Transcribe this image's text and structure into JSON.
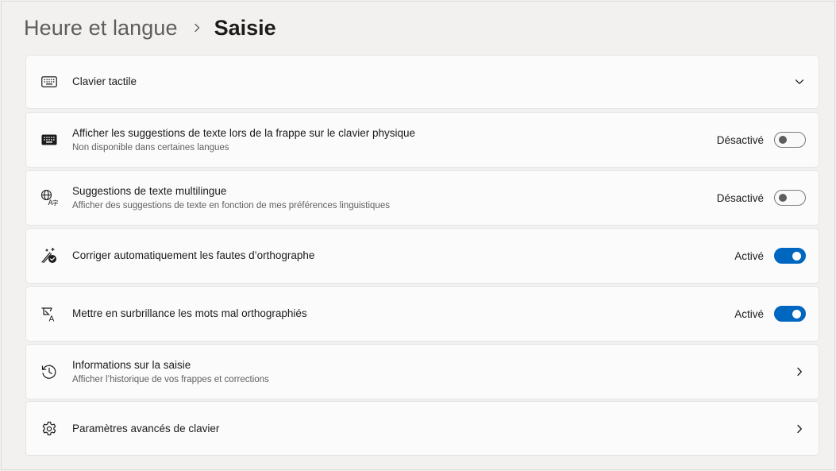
{
  "breadcrumb": {
    "parent": "Heure et langue",
    "current": "Saisie"
  },
  "settings": [
    {
      "title": "Clavier tactile",
      "subtitle": "",
      "icon": "keyboard-outline-icon",
      "control": "expand"
    },
    {
      "title": "Afficher les suggestions de texte lors de la frappe sur le clavier physique",
      "subtitle": "Non disponible dans certaines langues",
      "icon": "keyboard-filled-icon",
      "control": "toggle",
      "state_label": "Désactivé",
      "on": false
    },
    {
      "title": "Suggestions de texte multilingue",
      "subtitle": "Afficher des suggestions de texte en fonction de mes préférences linguistiques",
      "icon": "language-icon",
      "control": "toggle",
      "state_label": "Désactivé",
      "on": false
    },
    {
      "title": "Corriger automatiquement les fautes d’orthographe",
      "subtitle": "",
      "icon": "autocorrect-icon",
      "control": "toggle",
      "state_label": "Activé",
      "on": true
    },
    {
      "title": "Mettre en surbrillance les mots mal orthographiés",
      "subtitle": "",
      "icon": "highlight-spelling-icon",
      "control": "toggle",
      "state_label": "Activé",
      "on": true
    },
    {
      "title": "Informations sur la saisie",
      "subtitle": "Afficher l’historique de vos frappes et corrections",
      "icon": "history-icon",
      "control": "navigate"
    },
    {
      "title": "Paramètres avancés de clavier",
      "subtitle": "",
      "icon": "gear-icon",
      "control": "navigate"
    }
  ],
  "colors": {
    "accent": "#0067c0",
    "background": "#f3f1ef",
    "card": "#fbfbfb"
  }
}
